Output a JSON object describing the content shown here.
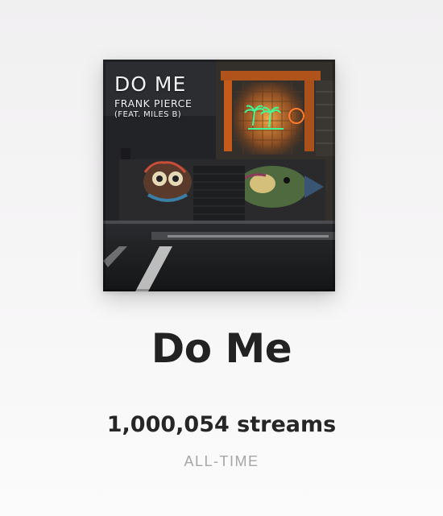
{
  "artwork": {
    "title": "DO ME",
    "artist": "FRANK PIERCE",
    "featuring": "(FEAT. MILES B)"
  },
  "track": {
    "title": "Do Me",
    "streams": "1,000,054 streams",
    "period": "ALL-TIME"
  },
  "colors": {
    "background": "#f3f2f3",
    "title_text": "#222222",
    "streams_text": "#262626",
    "period_text": "#a6a6a6",
    "neon_green": "#3dff9a",
    "neon_orange": "#ff7a2a"
  }
}
